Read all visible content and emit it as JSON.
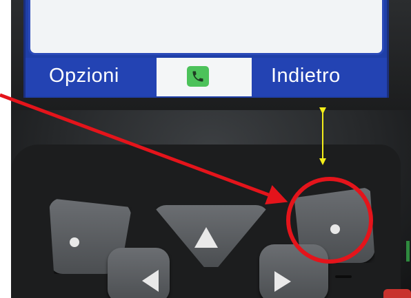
{
  "screen": {
    "softkey_left": "Opzioni",
    "softkey_right": "Indietro",
    "call_icon": "phone-icon",
    "bar_color": "#2343b3"
  },
  "annotations": {
    "arrow_color": "#e4141b",
    "circle_color": "#e4141b",
    "double_arrow_color": "#f5ef1a"
  }
}
